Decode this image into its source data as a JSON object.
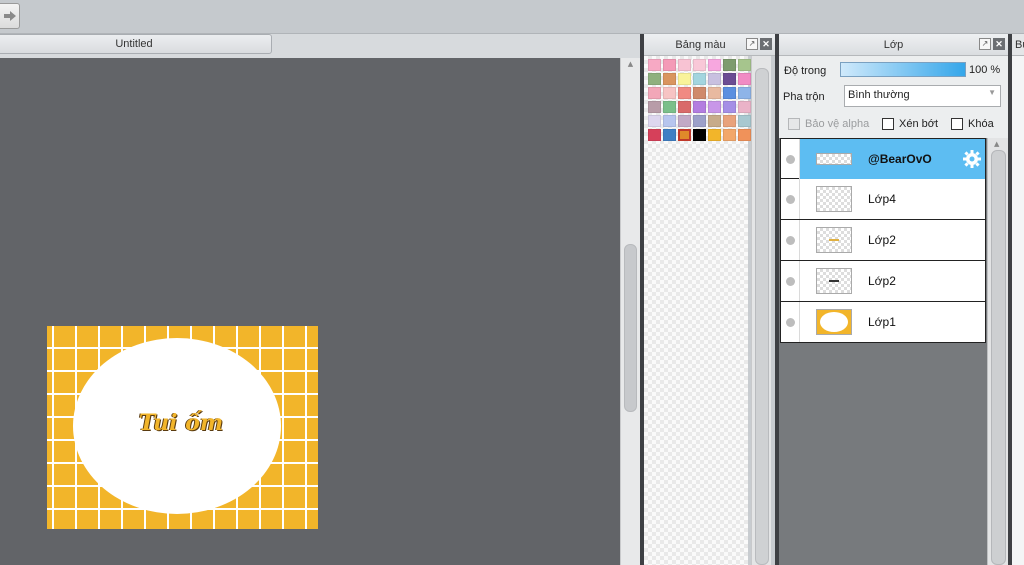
{
  "document": {
    "tab_title": "Untitled"
  },
  "artwork": {
    "text": "Tui ốm",
    "background_color": "#f2b52a"
  },
  "palette_panel": {
    "title": "Bảng màu",
    "swatches": [
      "#f7a9c4",
      "#f49ab7",
      "#f8c3d3",
      "#f9c8d8",
      "#f7a7df",
      "#7e9c6e",
      "#a6c58d",
      "#8fb07e",
      "#d9955f",
      "#f9f39a",
      "#a3d5df",
      "#c8c0e0",
      "#6b4c93",
      "#f08bc4",
      "#f2a7b8",
      "#f7c4c4",
      "#f08a82",
      "#cf8a6b",
      "#e8b9a0",
      "#5b8fe0",
      "#8eb4e8",
      "#b89ca8",
      "#7bbf8a",
      "#d96a6a",
      "#b37de0",
      "#c896e8",
      "#a58fe6",
      "#eab3c8",
      "#ddd6ee",
      "#b7c5ee",
      "#c2a9c6",
      "#9ca0c9",
      "#c7ab8a",
      "#e8a27c",
      "#a8c8d0",
      "#d6405a",
      "#3f7fc4",
      "#e08a2a",
      "#000000",
      "#f2b52a",
      "#f2a76a",
      "#f0925a"
    ],
    "selected_index": 37
  },
  "layer_panel": {
    "title": "Lớp",
    "opacity_label": "Độ trong",
    "opacity_value": "100 %",
    "opacity_fraction": 1.0,
    "blend_label": "Pha trộn",
    "blend_mode": "Bình thường",
    "protect_alpha_label": "Bảo vệ alpha",
    "clipping_label": "Xén bớt",
    "lock_label": "Khóa",
    "layers": [
      {
        "name": "@BearOvO",
        "selected": true
      },
      {
        "name": "Lớp4",
        "selected": false
      },
      {
        "name": "Lớp2",
        "selected": false
      },
      {
        "name": "Lớp2",
        "selected": false
      },
      {
        "name": "Lớp1",
        "selected": false
      }
    ]
  },
  "right_panel": {
    "title": "Bu"
  }
}
